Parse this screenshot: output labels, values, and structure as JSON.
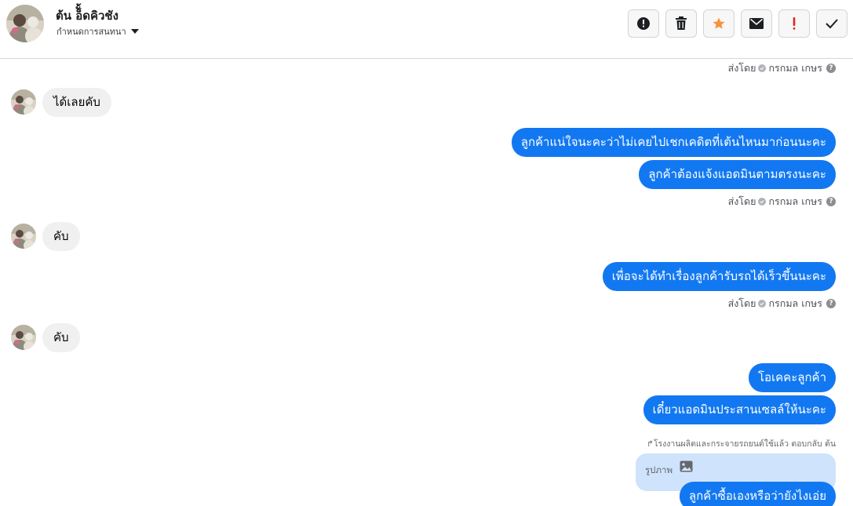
{
  "header": {
    "contact_name": "ต้น อ็ั้ดคิวชัง",
    "label_select": "กำหนดการสนทนา",
    "actions": [
      {
        "icon": "alert-circle-icon",
        "name": "mark-important-button"
      },
      {
        "icon": "trash-icon",
        "name": "delete-button"
      },
      {
        "icon": "star-icon",
        "name": "star-button",
        "color": "#f7923a"
      },
      {
        "icon": "envelope-icon",
        "name": "mark-unread-button"
      },
      {
        "icon": "exclamation-icon",
        "name": "mark-spam-button",
        "color": "#e02424"
      },
      {
        "icon": "checkmark-icon",
        "name": "mark-done-button"
      }
    ]
  },
  "sent_by": {
    "prefix": "ส่งโดย",
    "agent": "กรกมล เกษร",
    "help": "?"
  },
  "messages": {
    "in_1": "ได้เลยคับ",
    "out_1": "ลูกค้าแน่ใจนะคะว่าไม่เคยไปเชกเคดิตที่เต้นไหนมาก่อนนะคะ",
    "out_2": "ลูกค้าต้องแจ้งแอดมินตามตรงนะคะ",
    "in_2": "คับ",
    "out_3": "เพื่อจะได้ทำเรื่องลูกค้ารับรถได้เร็วขึ้นนะคะ",
    "in_3": "คับ",
    "out_4": "โอเคคะลูกค้า",
    "out_5": "เดี๋ยวแอดมินประสานเซลล์ให้นะคะ",
    "reply_note": "โรงงานผลิตและกระจายรถยนต์ใช้แล้ว ตอบกลับ ต้น",
    "reply_box_label": "รูปภาพ",
    "out_6": "ลูกค้าซื้อเองหรือว่ายังไงเอ่ย"
  },
  "colors": {
    "outgoing_bubble": "#1278f2",
    "incoming_bubble": "#f0f0f0",
    "reply_box": "#cfe3fc"
  }
}
